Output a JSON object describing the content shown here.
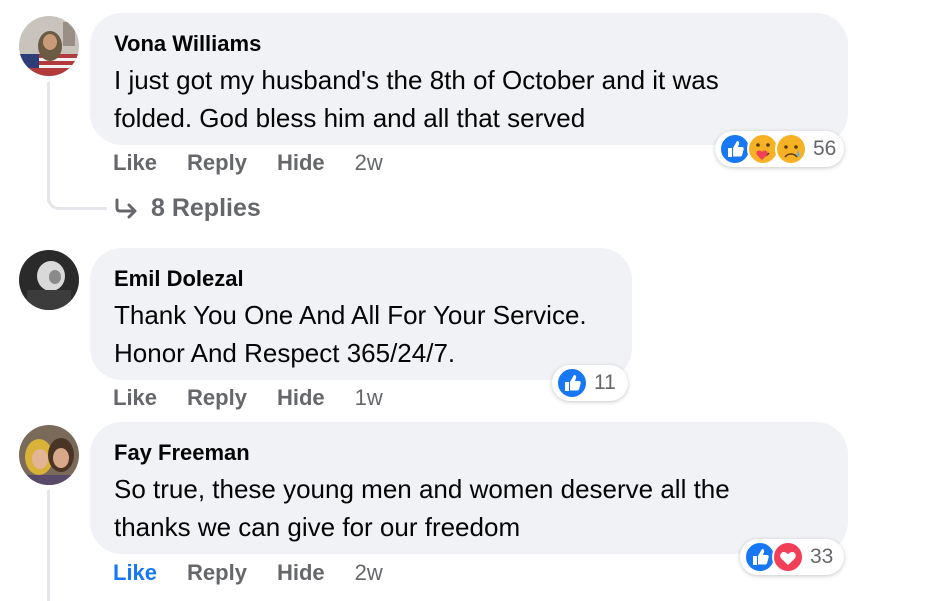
{
  "comments": [
    {
      "author": "Vona Williams",
      "text_lines": [
        "I just got my husband's the 8th of October and it was",
        "folded. God bless him and all that served"
      ],
      "reactions": {
        "icons": [
          "like-icon",
          "care-icon",
          "sad-icon"
        ],
        "count": "56"
      },
      "actions": {
        "like": "Like",
        "reply": "Reply",
        "hide": "Hide",
        "time": "2w"
      },
      "liked": false
    },
    {
      "author": "Emil Dolezal",
      "text_lines": [
        "Thank You One And All For Your Service.",
        "Honor And Respect 365/24/7."
      ],
      "reactions": {
        "icons": [
          "like-icon"
        ],
        "count": "11"
      },
      "actions": {
        "like": "Like",
        "reply": "Reply",
        "hide": "Hide",
        "time": "1w"
      },
      "liked": false
    },
    {
      "author": "Fay Freeman",
      "text_lines": [
        "So true, these young men and women deserve all the",
        "thanks we can give for our freedom"
      ],
      "reactions": {
        "icons": [
          "like-icon",
          "love-icon"
        ],
        "count": "33"
      },
      "actions": {
        "like": "Like",
        "reply": "Reply",
        "hide": "Hide",
        "time": "2w"
      },
      "liked": true
    }
  ],
  "replies_link": {
    "label": "8 Replies"
  },
  "colors": {
    "bubble": "#f0f2f5",
    "secondary_text": "#65676b",
    "like_blue": "#1877f2",
    "love_red": "#f33e58",
    "reaction_yellow": "#f7b125"
  }
}
